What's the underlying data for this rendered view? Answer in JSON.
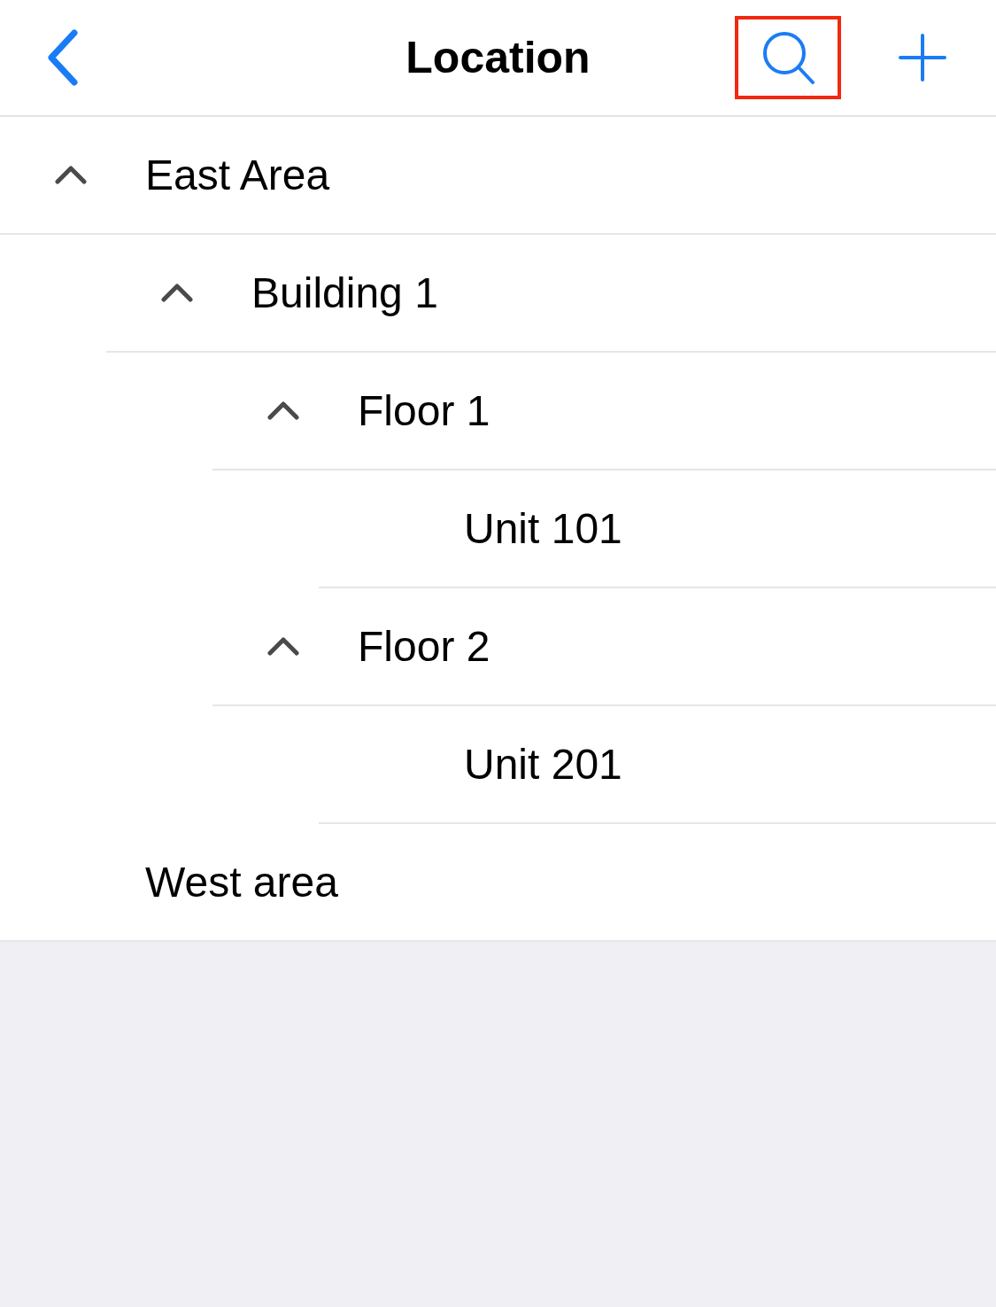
{
  "nav_bar": {
    "title": "Location",
    "search_button": {
      "highlighted": true
    }
  },
  "tree": [
    {
      "label": "East Area",
      "expanded": true,
      "children": [
        {
          "label": "Building 1",
          "expanded": true,
          "children": [
            {
              "label": "Floor 1",
              "expanded": true,
              "children": [
                {
                  "label": "Unit 101"
                }
              ]
            },
            {
              "label": "Floor 2",
              "expanded": true,
              "children": [
                {
                  "label": "Unit 201"
                }
              ]
            }
          ]
        }
      ]
    },
    {
      "label": "West area"
    }
  ]
}
